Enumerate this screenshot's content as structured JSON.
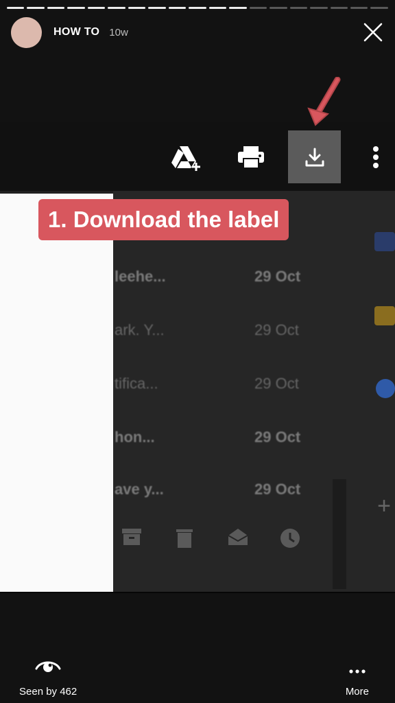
{
  "story": {
    "title": "HOW TO",
    "age": "10w",
    "progress_total_segments": 19,
    "progress_completed_segments": 12
  },
  "media": {
    "toolbar_icons": [
      "drive-add-icon",
      "print-icon",
      "download-icon",
      "more-vert-icon"
    ],
    "rows": [
      {
        "snippet": "leehe...",
        "date": "29 Oct",
        "bold": true
      },
      {
        "snippet": "ark. Y...",
        "date": "29 Oct",
        "bold": false
      },
      {
        "snippet": "tifica...",
        "date": "29 Oct",
        "bold": false
      },
      {
        "snippet": "hon...",
        "date": "29 Oct",
        "bold": true
      },
      {
        "snippet": "ave y...",
        "date": "29 Oct",
        "bold": true
      }
    ]
  },
  "overlay": {
    "label": "1. Download the label",
    "background": "#d8575e"
  },
  "footer": {
    "seen_label": "Seen by 462",
    "more_label": "More"
  }
}
